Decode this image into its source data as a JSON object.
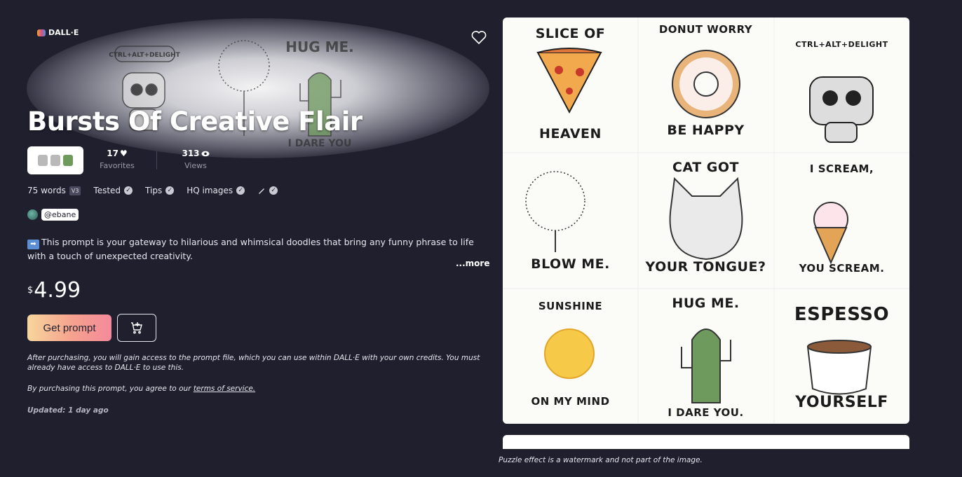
{
  "brand": {
    "label": "DALL·E",
    "icon": "palette-icon"
  },
  "prompt": {
    "title": "Bursts Of Creative Flair",
    "stats": {
      "favorites_count": "17",
      "favorites_label": "Favorites",
      "views_count": "313",
      "views_label": "Views"
    },
    "meta": {
      "words": "75 words",
      "version": "V3",
      "tested": "Tested",
      "tips": "Tips",
      "hq_images": "HQ images"
    },
    "author": "@ebane",
    "description": "This prompt is your gateway to hilarious and whimsical doodles that bring any funny phrase to life with a touch of unexpected creativity.",
    "more_label": "...more",
    "price": {
      "currency": "$",
      "amount": "4.99"
    },
    "get_button": "Get prompt",
    "fine_print_1": "After purchasing, you will gain access to the prompt file, which you can use within DALL·E with your own credits. You must already have access to DALL·E to use this.",
    "fine_print_2_prefix": "By purchasing this prompt, you agree to our ",
    "fine_print_2_link": "terms of service.",
    "updated": "Updated: 1 day ago"
  },
  "gallery": {
    "captions": [
      [
        "SLICE OF",
        "HEAVEN"
      ],
      [
        "DONUT WORRY",
        "BE HAPPY"
      ],
      [
        "CTRL+ALT+DELIGHT",
        ""
      ],
      [
        "",
        "BLOW ME."
      ],
      [
        "CAT GOT",
        "YOUR TONGUE?"
      ],
      [
        "I SCREAM,",
        "YOU SCREAM."
      ],
      [
        "SUNSHINE",
        "ON MY MIND"
      ],
      [
        "HUG ME.",
        "I DARE YOU."
      ],
      [
        "ESPESSO",
        "YOURSELF"
      ]
    ],
    "hero_captions": {
      "robot": "CTRL+ALT+DELIGHT",
      "cactus_top": "HUG ME.",
      "cactus_bottom": "I DARE YOU"
    },
    "watermark_note": "Puzzle effect is a watermark and not part of the image."
  },
  "colors": {
    "background": "#1f1f2e",
    "button_gradient_start": "#f7d69c",
    "button_gradient_end": "#f48a9a"
  }
}
